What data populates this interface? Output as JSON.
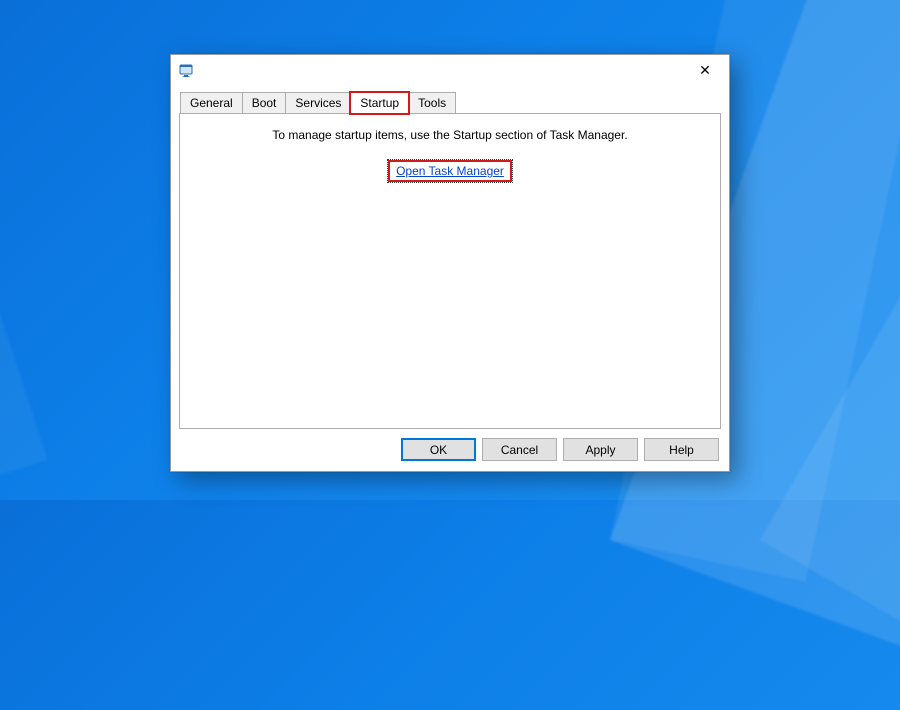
{
  "tabs": {
    "items": [
      {
        "label": "General"
      },
      {
        "label": "Boot"
      },
      {
        "label": "Services"
      },
      {
        "label": "Startup"
      },
      {
        "label": "Tools"
      }
    ],
    "active_index": 3
  },
  "startup_panel": {
    "info_text": "To manage startup items, use the Startup section of Task Manager.",
    "link_text": "Open Task Manager"
  },
  "buttons": {
    "ok": "OK",
    "cancel": "Cancel",
    "apply": "Apply",
    "help": "Help"
  },
  "titlebar": {
    "close_glyph": "✕"
  }
}
